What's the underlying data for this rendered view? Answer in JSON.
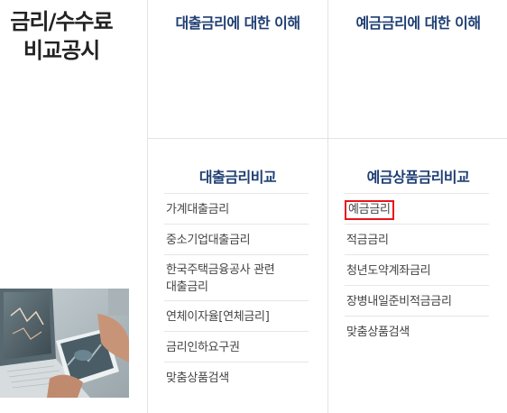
{
  "page_title": {
    "line1": "금리/수수료",
    "line2": "비교공시"
  },
  "top_links": {
    "loan": "대출금리에 대한 이해",
    "deposit": "예금금리에 대한 이해"
  },
  "loan_section": {
    "title": "대출금리비교",
    "items": [
      "가계대출금리",
      "중소기업대출금리",
      "한국주택금융공사 관련\n대출금리",
      "연체이자율[연체금리]",
      "금리인하요구권",
      "맞춤상품검색"
    ]
  },
  "deposit_section": {
    "title": "예금상품금리비교",
    "items": [
      "예금금리",
      "적금금리",
      "청년도약계좌금리",
      "장병내일준비적금금리",
      "맞춤상품검색"
    ]
  },
  "colors": {
    "heading": "#1f3f73",
    "highlight_border": "#e8141b",
    "divider": "#e3e3e3"
  }
}
